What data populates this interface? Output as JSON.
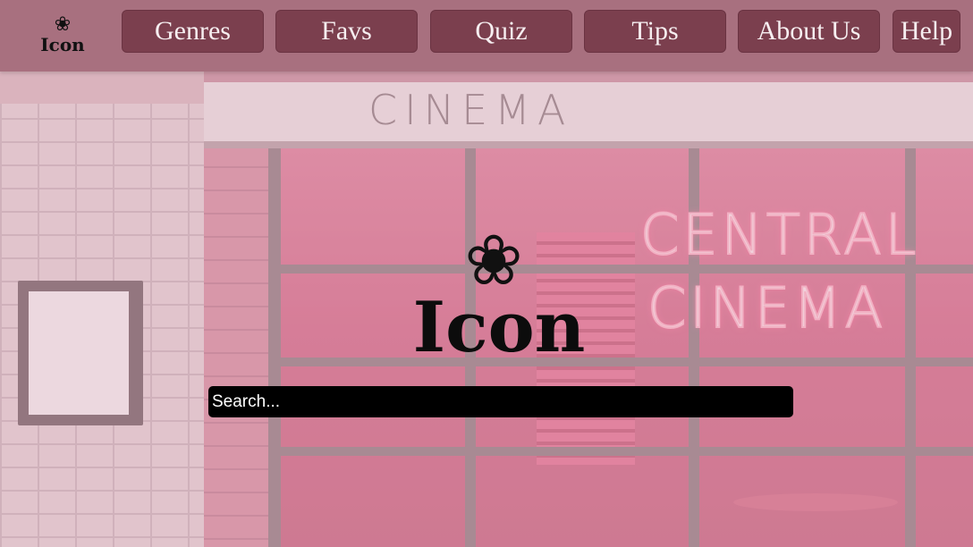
{
  "colors": {
    "navbar": "#a8707f",
    "nav_button": "#7b3f4e",
    "nav_text": "#f6eef0",
    "search_bg": "#000000"
  },
  "brand": {
    "icon": "flower-icon",
    "glyph": "❀",
    "label": "Icon"
  },
  "nav": {
    "items": [
      {
        "label": "Genres"
      },
      {
        "label": "Favs"
      },
      {
        "label": "Quiz"
      },
      {
        "label": "Tips"
      },
      {
        "label": "About Us"
      },
      {
        "label": "Help"
      }
    ]
  },
  "hero": {
    "icon": "flower-icon",
    "glyph": "❀",
    "title": "Icon"
  },
  "search": {
    "placeholder": "Search...",
    "value": ""
  },
  "background": {
    "marquee": "CINEMA",
    "neon_line1": "CENTRAL",
    "neon_line2": "CINEMA"
  }
}
